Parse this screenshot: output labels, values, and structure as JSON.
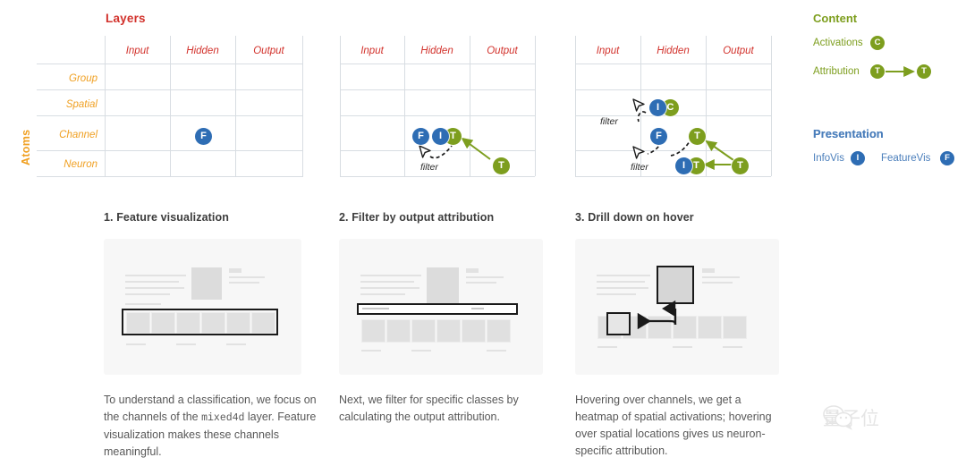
{
  "matrices": {
    "title": "Layers",
    "axis_label": "Atoms",
    "columns": [
      "Input",
      "Hidden",
      "Output"
    ],
    "rows": [
      "Group",
      "Spatial",
      "Channel",
      "Neuron"
    ],
    "filter_label": "filter",
    "badges": {
      "m1": [
        {
          "letter": "F",
          "color": "blue",
          "col": "Hidden",
          "row": "Channel"
        }
      ],
      "m2": [
        {
          "letter": "F",
          "color": "blue",
          "col": "Hidden",
          "row": "Channel"
        },
        {
          "letter": "I",
          "color": "blue",
          "col": "Hidden",
          "row": "Channel"
        },
        {
          "letter": "T",
          "color": "olive",
          "col": "Hidden",
          "row": "Channel"
        },
        {
          "letter": "T",
          "color": "olive",
          "col": "Output",
          "row": "Neuron"
        }
      ],
      "m3": [
        {
          "letter": "I",
          "color": "blue",
          "col": "Hidden",
          "row": "Spatial"
        },
        {
          "letter": "C",
          "color": "olive",
          "col": "Hidden",
          "row": "Spatial"
        },
        {
          "letter": "F",
          "color": "blue",
          "col": "Hidden",
          "row": "Channel"
        },
        {
          "letter": "T",
          "color": "olive",
          "col": "Output",
          "row": "Channel"
        },
        {
          "letter": "I",
          "color": "blue",
          "col": "Output",
          "row": "Neuron"
        },
        {
          "letter": "T",
          "color": "olive",
          "col": "Output",
          "row": "Neuron"
        },
        {
          "letter": "T",
          "color": "olive",
          "col": "Output",
          "row": "Neuron"
        }
      ]
    }
  },
  "panels": [
    {
      "title": "1. Feature visualization",
      "caption_pre": "To understand a classification, we focus on the channels of the ",
      "caption_mono": "mixed4d",
      "caption_post": " layer. Feature visualization makes these channels meaningful."
    },
    {
      "title": "2. Filter by output attribution",
      "caption_pre": "Next, we filter for specific classes by calculating the output attribution.",
      "caption_mono": "",
      "caption_post": ""
    },
    {
      "title": "3. Drill down on hover",
      "caption_pre": "Hovering over channels, we get a heatmap of spatial activations; hovering over spatial locations gives us neuron-specific attribution.",
      "caption_mono": "",
      "caption_post": ""
    }
  ],
  "legend": {
    "content_heading": "Content",
    "activations_label": "Activations",
    "activations_badge": "C",
    "attribution_label": "Attribution",
    "attribution_badge_from": "T",
    "attribution_badge_to": "T",
    "presentation_heading": "Presentation",
    "infovis_label": "InfoVis",
    "infovis_badge": "I",
    "featurevis_label": "FeatureVis",
    "featurevis_badge": "F"
  },
  "watermark": {
    "text": "量子位"
  },
  "colors": {
    "blue": "#2e6db4",
    "olive": "#7d9e1e",
    "red": "#d2322c",
    "orange": "#f0a022",
    "presentation_blue": "#4a7ebb"
  }
}
